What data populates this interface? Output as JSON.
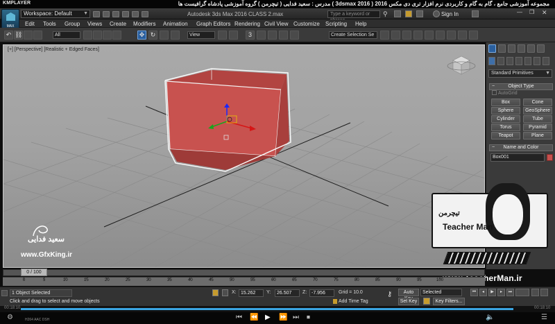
{
  "kmplayer": {
    "logo": "KMPLAYER",
    "title": "مجموعه آموزشی جامع ، گام به گام و کاربردی نرم افزار تری دی مکس 2016  ( 3dsmax 2016 )   مدرس : سعید فدایی ( تیچرمن ) گروه آموزشی پادشاه گرافیست ها",
    "time": "00:18:10",
    "time_total": "00:18:10",
    "codec_info": "H264  AAC  DSH",
    "progress": 0.96
  },
  "max_titlebar": {
    "app_button_label": "MAX",
    "workspace_label": "Workspace: Default",
    "document_title": "Autodesk 3ds Max 2016       CLASS 2.max",
    "search_placeholder": "Type a keyword or phrase",
    "sign_in": "Sign In"
  },
  "menu": [
    "Edit",
    "Tools",
    "Group",
    "Views",
    "Create",
    "Modifiers",
    "Animation",
    "Graph Editors",
    "Rendering",
    "Civil View",
    "Customize",
    "Scripting",
    "Help"
  ],
  "toolbar": {
    "filter_dropdown": "All",
    "view_dropdown": "View",
    "selection_set": "Create Selection Se"
  },
  "viewport": {
    "label": "[+] [Perspective] [Realistic + Edged Faces]",
    "object_color": "#c8524f"
  },
  "command_panel": {
    "category": "Standard Primitives",
    "object_type_header": "Object Type",
    "autogrid_label": "AutoGrid",
    "primitives": [
      "Box",
      "Cone",
      "Sphere",
      "GeoSphere",
      "Cylinder",
      "Tube",
      "Torus",
      "Pyramid",
      "Teapot",
      "Plane"
    ],
    "name_color_header": "Name and Color",
    "object_name": "Box001",
    "swatch_color": "#c7504d"
  },
  "watermarks": {
    "left_signature": "سعید فدایی",
    "left_site": "www.GfxKing.ir",
    "right_brand_fa": "تیچرمن",
    "right_brand_en": "Teacher Man",
    "right_site": "www.TeacherMan.ir"
  },
  "timeline": {
    "frame_display": "0 / 100",
    "ticks": [
      "0",
      "5",
      "10",
      "15",
      "20",
      "25",
      "30",
      "35",
      "40",
      "45",
      "50",
      "55",
      "60",
      "65",
      "70",
      "75",
      "80",
      "85",
      "90",
      "95",
      "100"
    ]
  },
  "status": {
    "selected_text": "1 Object Selected",
    "prompt": "Click and drag to select and move objects",
    "x_label": "X:",
    "x_value": "15.262",
    "y_label": "Y:",
    "y_value": "26.507",
    "z_label": "Z:",
    "z_value": "-7.956",
    "grid": "Grid = 10.0",
    "add_time_tag": "Add Time Tag",
    "auto_key": "Auto Key",
    "set_key": "Set Key",
    "selected_dropdown": "Selected",
    "key_filters": "Key Filters..."
  }
}
